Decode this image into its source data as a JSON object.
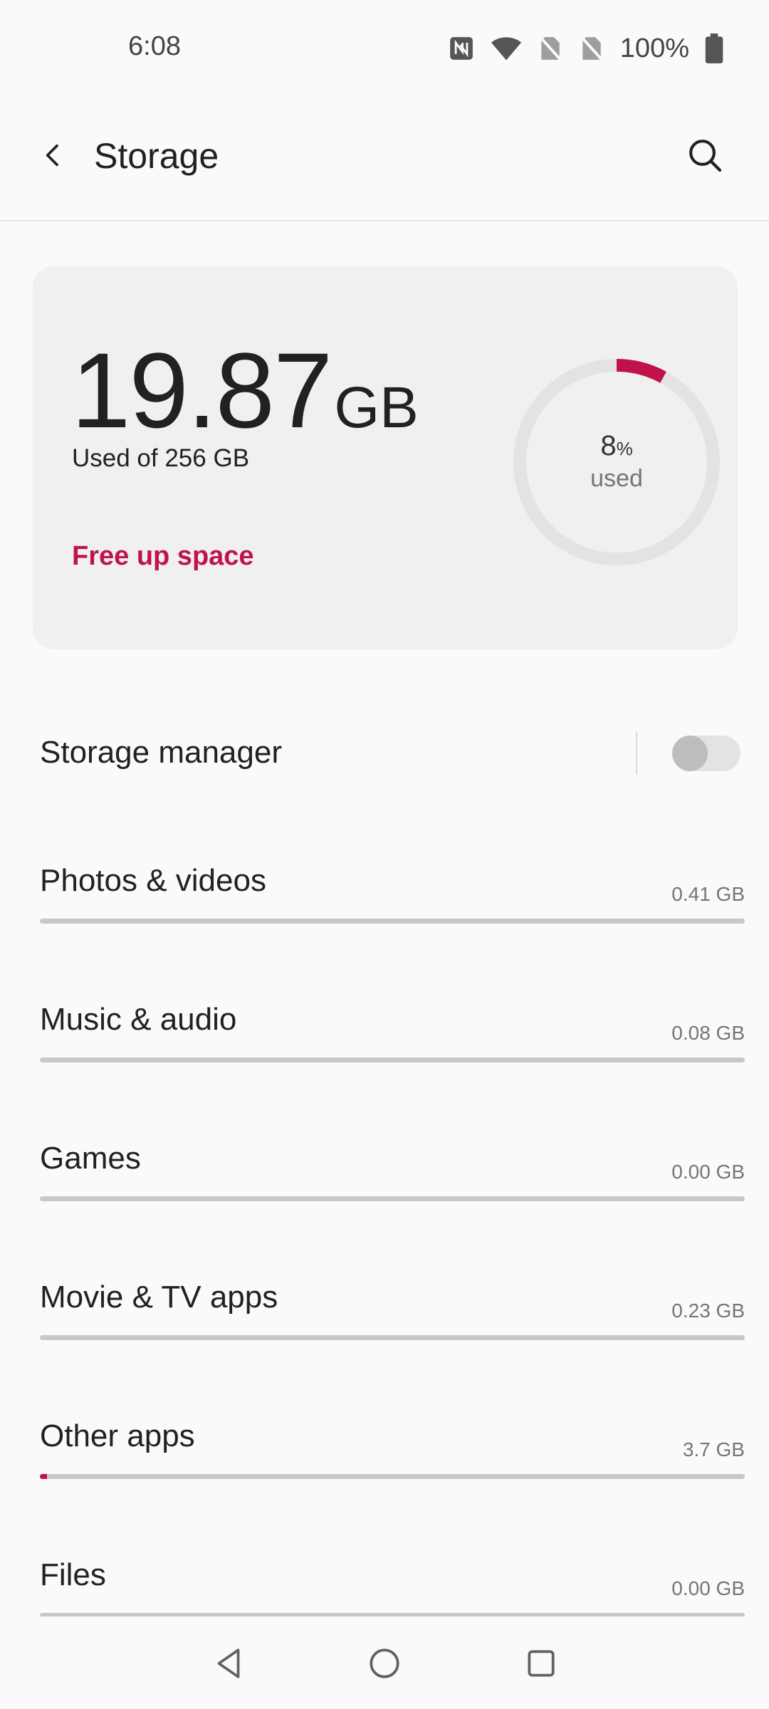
{
  "status_bar": {
    "time": "6:08",
    "battery_percent": "100%",
    "icons": [
      "nfc-icon",
      "wifi-icon",
      "no-sim-icon",
      "no-sim-icon",
      "battery-icon"
    ]
  },
  "app_bar": {
    "title": "Storage",
    "back_icon": "arrow-back-icon",
    "search_icon": "search-icon"
  },
  "summary": {
    "used_value": "19.87",
    "used_unit": "GB",
    "used_of": "Used of 256 GB",
    "free_up_label": "Free up space",
    "ring_percent": "8",
    "ring_percent_sign": "%",
    "ring_used_label": "used",
    "used_fraction": 0.08
  },
  "storage_manager": {
    "label": "Storage manager",
    "enabled": false
  },
  "categories": [
    {
      "label": "Photos & videos",
      "size": "0.41 GB",
      "fraction": 0.0
    },
    {
      "label": "Music & audio",
      "size": "0.08 GB",
      "fraction": 0.0
    },
    {
      "label": "Games",
      "size": "0.00 GB",
      "fraction": 0.0
    },
    {
      "label": "Movie & TV apps",
      "size": "0.23 GB",
      "fraction": 0.0
    },
    {
      "label": "Other apps",
      "size": "3.7 GB",
      "fraction": 0.01
    },
    {
      "label": "Files",
      "size": "0.00 GB",
      "fraction": 0.0
    }
  ],
  "colors": {
    "accent": "#c0134a",
    "track": "#c8c8c8",
    "card_bg": "#f0f0f0",
    "ring_track": "#e3e3e3"
  },
  "nav_bar": {
    "icons": [
      "nav-back-icon",
      "nav-home-icon",
      "nav-recents-icon"
    ]
  }
}
